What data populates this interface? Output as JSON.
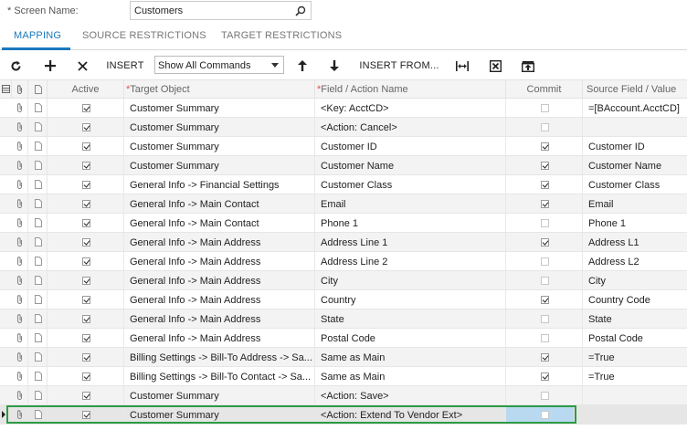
{
  "screen_name": {
    "label": "Screen Name:",
    "required_mark": "*",
    "value": "Customers"
  },
  "tabs": [
    {
      "label": "MAPPING",
      "active": true
    },
    {
      "label": "SOURCE RESTRICTIONS",
      "active": false
    },
    {
      "label": "TARGET RESTRICTIONS",
      "active": false
    }
  ],
  "toolbar": {
    "insert_label": "INSERT",
    "commands_select": "Show All Commands",
    "insert_from_label": "INSERT FROM..."
  },
  "columns": {
    "active": "Active",
    "target_object": "Target Object",
    "field_action": "Field / Action Name",
    "commit": "Commit",
    "source_field": "Source Field / Value",
    "required_mark": "*"
  },
  "rows": [
    {
      "active": true,
      "target": "Customer Summary",
      "field": "<Key: AcctCD>",
      "commit": false,
      "source": "=[BAccount.AcctCD]"
    },
    {
      "active": true,
      "target": "Customer Summary",
      "field": "<Action: Cancel>",
      "commit": false,
      "source": ""
    },
    {
      "active": true,
      "target": "Customer Summary",
      "field": "Customer ID",
      "commit": true,
      "source": "Customer ID"
    },
    {
      "active": true,
      "target": "Customer Summary",
      "field": "Customer Name",
      "commit": true,
      "source": "Customer Name"
    },
    {
      "active": true,
      "target": "General Info -> Financial Settings",
      "field": "Customer Class",
      "commit": true,
      "source": "Customer Class"
    },
    {
      "active": true,
      "target": "General Info -> Main Contact",
      "field": "Email",
      "commit": true,
      "source": "Email"
    },
    {
      "active": true,
      "target": "General Info -> Main Contact",
      "field": "Phone 1",
      "commit": false,
      "source": "Phone 1"
    },
    {
      "active": true,
      "target": "General Info -> Main Address",
      "field": "Address Line 1",
      "commit": true,
      "source": "Address L1"
    },
    {
      "active": true,
      "target": "General Info -> Main Address",
      "field": "Address Line 2",
      "commit": false,
      "source": "Address L2"
    },
    {
      "active": true,
      "target": "General Info -> Main Address",
      "field": "City",
      "commit": false,
      "source": "City"
    },
    {
      "active": true,
      "target": "General Info -> Main Address",
      "field": "Country",
      "commit": true,
      "source": "Country Code"
    },
    {
      "active": true,
      "target": "General Info -> Main Address",
      "field": "State",
      "commit": false,
      "source": "State"
    },
    {
      "active": true,
      "target": "General Info -> Main Address",
      "field": "Postal Code",
      "commit": false,
      "source": "Postal Code"
    },
    {
      "active": true,
      "target": "Billing Settings -> Bill-To Address -> Sa...",
      "field": "Same as Main",
      "commit": true,
      "source": "=True"
    },
    {
      "active": true,
      "target": "Billing Settings -> Bill-To Contact -> Sa...",
      "field": "Same as Main",
      "commit": true,
      "source": "=True"
    },
    {
      "active": true,
      "target": "Customer Summary",
      "field": "<Action: Save>",
      "commit": false,
      "source": ""
    },
    {
      "active": true,
      "target": "Customer Summary",
      "field": "<Action: Extend To Vendor Ext>",
      "commit": false,
      "source": "",
      "selected": true
    }
  ],
  "colors": {
    "accent": "#1b79bd",
    "selection_outline": "#2e9b45",
    "commit_highlight": "#b9d9f0"
  }
}
